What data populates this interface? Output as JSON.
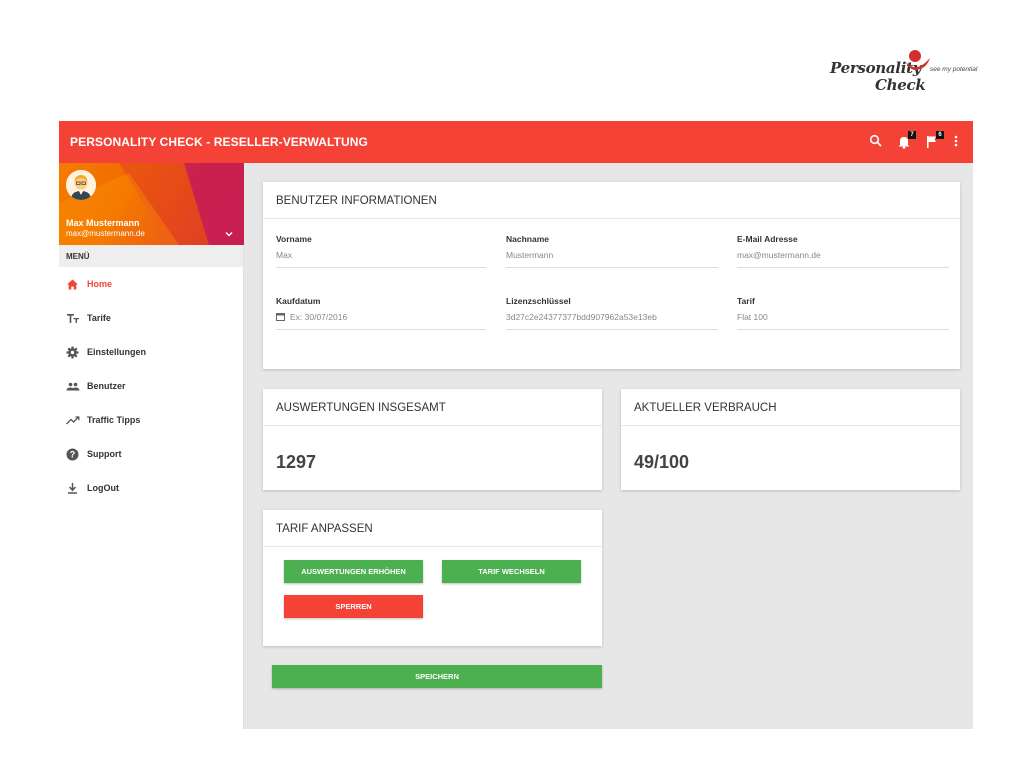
{
  "brand": {
    "line1": "Personality",
    "line2": "Check",
    "tagline": "see my potential",
    "colors": {
      "accent": "#d32f2f",
      "text": "#333333"
    }
  },
  "topbar": {
    "title": "PERSONALITY CHECK - RESELLER-VERWALTUNG",
    "color": "#f44336",
    "icons": [
      "search-icon",
      "notifications-icon",
      "flag-icon",
      "more-vert-icon"
    ],
    "notifications_badge": "7",
    "flag_badge": "6"
  },
  "sidebar": {
    "user_name": "Max Mustermann",
    "user_email": "max@mustermann.de",
    "menu_label": "MENÜ",
    "items": [
      {
        "label": "Home",
        "icon": "home-icon",
        "active": true
      },
      {
        "label": "Tarife",
        "icon": "text-size-icon",
        "active": false
      },
      {
        "label": "Einstellungen",
        "icon": "gear-icon",
        "active": false
      },
      {
        "label": "Benutzer",
        "icon": "people-icon",
        "active": false
      },
      {
        "label": "Traffic Tipps",
        "icon": "trending-up-icon",
        "active": false
      },
      {
        "label": "Support",
        "icon": "help-icon",
        "active": false
      },
      {
        "label": "LogOut",
        "icon": "download-icon",
        "active": false
      }
    ]
  },
  "user_info": {
    "title": "BENUTZER INFORMATIONEN",
    "vorname": {
      "label": "Vorname",
      "value": "Max"
    },
    "nachname": {
      "label": "Nachname",
      "value": "Mustermann"
    },
    "email": {
      "label": "E-Mail Adresse",
      "value": "max@mustermann.de"
    },
    "kaufdatum": {
      "label": "Kaufdatum",
      "placeholder": "Ex: 30/07/2016"
    },
    "lizenz": {
      "label": "Lizenzschlüssel",
      "value": "3d27c2e24377377bdd907962a53e13eb"
    },
    "tarif": {
      "label": "Tarif",
      "value": "Flat 100"
    }
  },
  "auswertungen": {
    "title": "AUSWERTUNGEN INSGESAMT",
    "value": "1297"
  },
  "verbrauch": {
    "title": "AKTUELLER VERBRAUCH",
    "value": "49/100"
  },
  "tarif_anpassen": {
    "title": "TARIF ANPASSEN",
    "btn_erhoehen": "AUSWERTUNGEN ERHÖHEN",
    "btn_wechseln": "TARIF WECHSELN",
    "btn_sperren": "SPERREN"
  },
  "save_label": "SPEICHERN",
  "colors": {
    "primary": "#f44336",
    "success": "#4caf50",
    "background": "#e7e7e7"
  }
}
